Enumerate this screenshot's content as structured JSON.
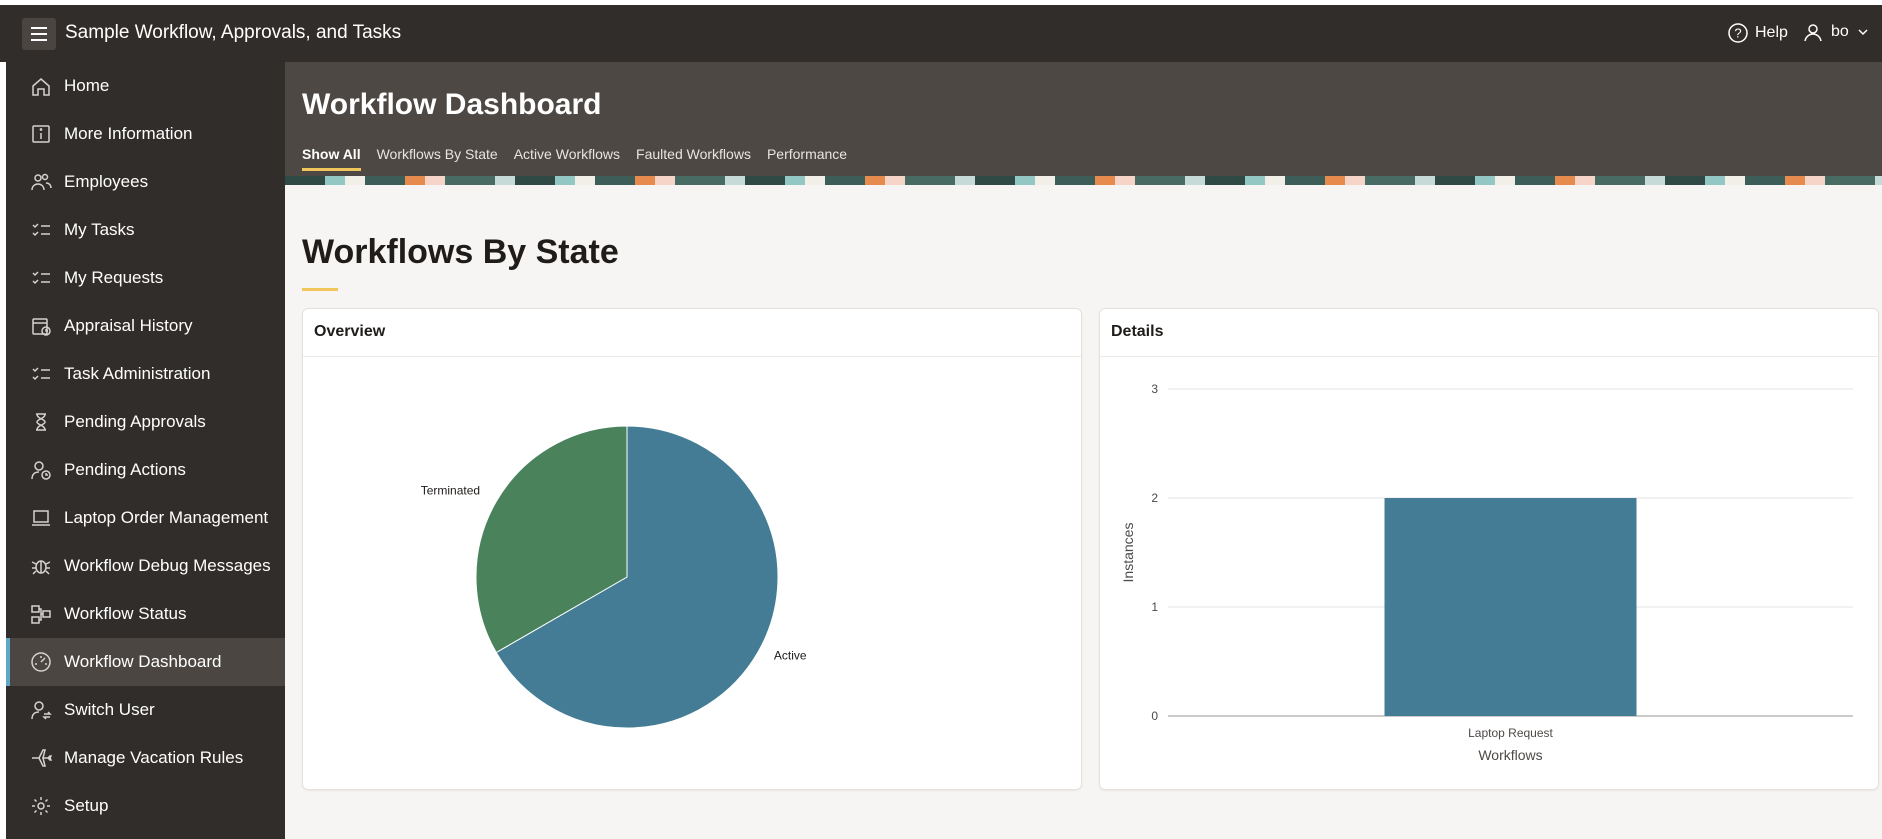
{
  "header": {
    "app_title": "Sample Workflow, Approvals, and Tasks",
    "help_label": "Help",
    "user_label": "bo"
  },
  "sidebar": {
    "items": [
      {
        "label": "Home",
        "icon": "home-icon"
      },
      {
        "label": "More Information",
        "icon": "info-icon"
      },
      {
        "label": "Employees",
        "icon": "users-icon"
      },
      {
        "label": "My Tasks",
        "icon": "checklist-icon"
      },
      {
        "label": "My Requests",
        "icon": "checklist-icon"
      },
      {
        "label": "Appraisal History",
        "icon": "calendar-history-icon"
      },
      {
        "label": "Task Administration",
        "icon": "checklist-icon"
      },
      {
        "label": "Pending Approvals",
        "icon": "hourglass-icon"
      },
      {
        "label": "Pending Actions",
        "icon": "user-clock-icon"
      },
      {
        "label": "Laptop Order Management",
        "icon": "laptop-icon"
      },
      {
        "label": "Workflow Debug Messages",
        "icon": "bug-icon"
      },
      {
        "label": "Workflow Status",
        "icon": "workflow-icon"
      },
      {
        "label": "Workflow Dashboard",
        "icon": "dashboard-icon",
        "active": true
      },
      {
        "label": "Switch User",
        "icon": "switch-user-icon"
      },
      {
        "label": "Manage Vacation Rules",
        "icon": "plane-icon"
      },
      {
        "label": "Setup",
        "icon": "gear-icon"
      }
    ]
  },
  "hero": {
    "title": "Workflow Dashboard",
    "tabs": [
      "Show All",
      "Workflows By State",
      "Active Workflows",
      "Faulted Workflows",
      "Performance"
    ],
    "active_tab": "Show All"
  },
  "section": {
    "title": "Workflows By State"
  },
  "overview": {
    "title": "Overview"
  },
  "details": {
    "title": "Details"
  },
  "chart_data": [
    {
      "type": "pie",
      "slices": [
        {
          "label": "Active",
          "value": 2,
          "color": "#437c94"
        },
        {
          "label": "Terminated",
          "value": 1,
          "color": "#4a825b"
        }
      ]
    },
    {
      "type": "bar",
      "categories": [
        "Laptop Request"
      ],
      "values": [
        2
      ],
      "xlabel": "Workflows",
      "ylabel": "Instances",
      "ylim": [
        0,
        3
      ],
      "yticks": [
        "0",
        "1",
        "2",
        "3"
      ],
      "color": "#437c94",
      "grid": true
    }
  ],
  "colors": {
    "topbar": "#312d2a",
    "accent": "#f1c75b",
    "active_blue": "#437c94",
    "terminated_green": "#4a825b"
  }
}
